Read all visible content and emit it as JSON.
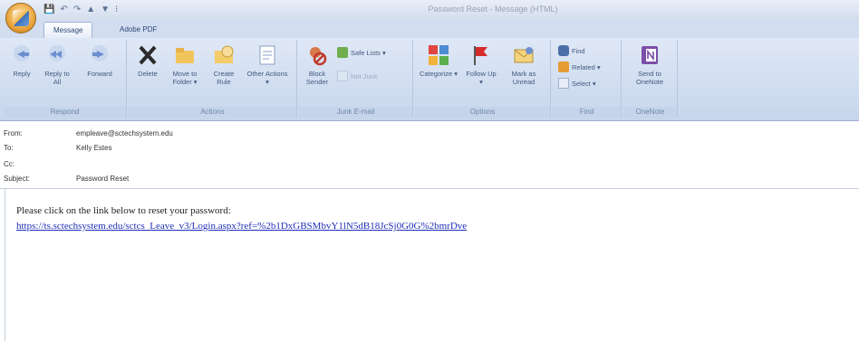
{
  "window": {
    "title": "Password Reset - Message (HTML)",
    "qat_items": [
      "💾",
      "↶",
      "↷",
      "▲",
      "▼",
      "⁝"
    ]
  },
  "tabs": [
    {
      "label": "Message",
      "active": true
    },
    {
      "label": "Adobe PDF",
      "active": false
    }
  ],
  "ribbon": {
    "respond": {
      "label": "Respond",
      "reply": "Reply",
      "reply_all": "Reply to All",
      "forward": "Forward"
    },
    "actions": {
      "label": "Actions",
      "delete": "Delete",
      "move_to_folder": "Move to Folder ▾",
      "create_rule": "Create Rule",
      "other_actions": "Other Actions ▾"
    },
    "junk": {
      "label": "Junk E-mail",
      "block_sender": "Block Sender",
      "safe_lists": "Safe Lists ▾",
      "not_junk": "Not Junk"
    },
    "options": {
      "label": "Options",
      "categorize": "Categorize ▾",
      "follow_up": "Follow Up ▾",
      "mark_unread": "Mark as Unread"
    },
    "find": {
      "label": "Find",
      "find": "Find",
      "related": "Related ▾",
      "select": "Select ▾"
    },
    "onenote": {
      "label": "OneNote",
      "send": "Send to OneNote"
    }
  },
  "headers": {
    "from_label": "From:",
    "from_value": "empleave@sctechsystem.edu",
    "to_label": "To:",
    "to_value": "Kelly Estes",
    "cc_label": "Cc:",
    "cc_value": "",
    "subject_label": "Subject:",
    "subject_value": "Password Reset"
  },
  "message": {
    "line1": "Please click on the link below to reset your password:",
    "link": "https://ts.sctechsystem.edu/sctcs_Leave_v3/Login.aspx?ref=%2b1DxGBSMbvY1lN5dB18JcSj0G0G%2bmrDve"
  },
  "colors": {
    "ribbon_bg": "#dfe8f6",
    "link": "#1f2fb8",
    "accent": "#2d4a7a"
  }
}
